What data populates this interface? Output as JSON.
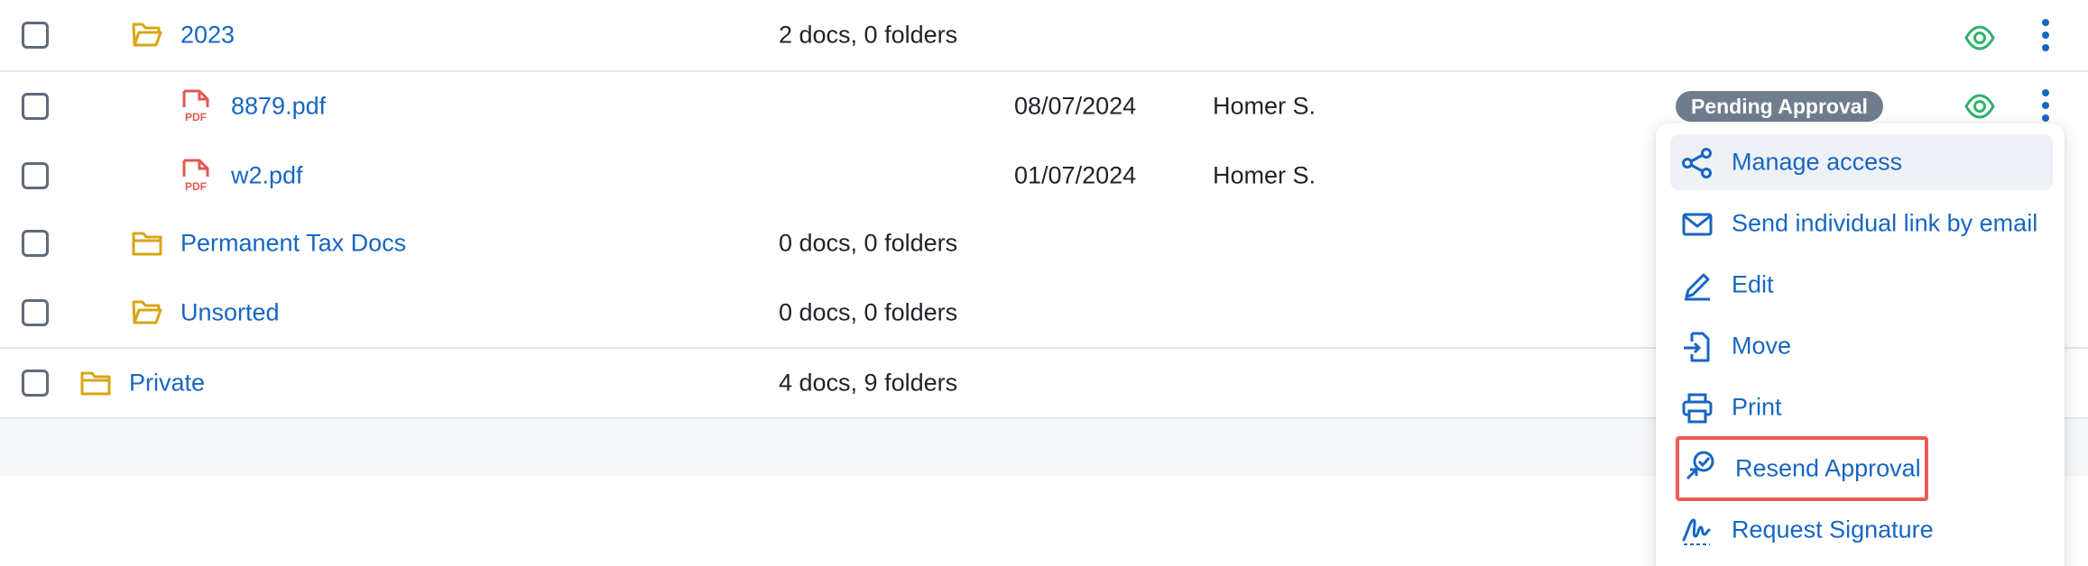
{
  "colors": {
    "link": "#1766c2",
    "folder": "#d8a515",
    "pdf": "#e05a4f",
    "eye": "#2fb36b",
    "badge_bg": "#6f7d8f",
    "highlight_border": "#ec5a55"
  },
  "rows": [
    {
      "type": "folder-open",
      "name": "2023",
      "count": "2 docs, 0 folders"
    },
    {
      "type": "pdf",
      "name": "8879.pdf",
      "date": "08/07/2024",
      "owner": "Homer S.",
      "status": "Pending Approval"
    },
    {
      "type": "pdf",
      "name": "w2.pdf",
      "date": "01/07/2024",
      "owner": "Homer S."
    },
    {
      "type": "folder",
      "name": "Permanent Tax Docs",
      "count": "0 docs, 0 folders"
    },
    {
      "type": "folder-open",
      "name": "Unsorted",
      "count": "0 docs, 0 folders"
    },
    {
      "type": "folder",
      "name": "Private",
      "count": "4 docs, 9 folders"
    }
  ],
  "menu": {
    "items": [
      {
        "label": "Manage access",
        "icon": "share-icon",
        "state": "hover"
      },
      {
        "label": "Send individual link by email",
        "icon": "mail-icon"
      },
      {
        "label": "Edit",
        "icon": "pencil-icon"
      },
      {
        "label": "Move",
        "icon": "move-file-icon"
      },
      {
        "label": "Print",
        "icon": "printer-icon"
      },
      {
        "label": "Resend Approval",
        "icon": "resend-approval-icon",
        "state": "highlighted"
      },
      {
        "label": "Request Signature",
        "icon": "signature-icon"
      }
    ]
  }
}
